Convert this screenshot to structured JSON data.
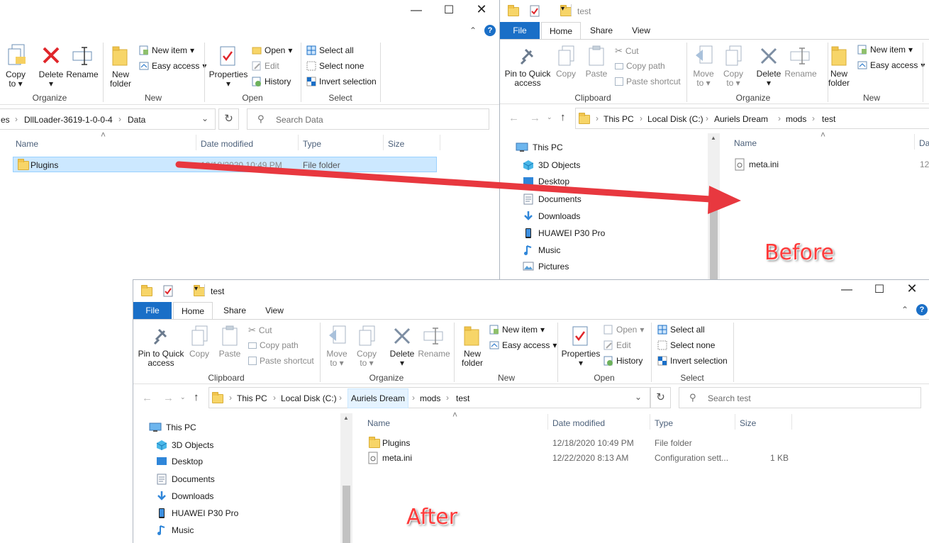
{
  "left_window": {
    "ribbon": {
      "copy_to": "Copy to",
      "delete": "Delete",
      "rename": "Rename",
      "new_folder": "New folder",
      "new_item": "New item",
      "easy_access": "Easy access",
      "properties": "Properties",
      "open": "Open",
      "edit": "Edit",
      "history": "History",
      "select_all": "Select all",
      "select_none": "Select none",
      "invert_selection": "Invert selection",
      "groups": {
        "organize": "Organize",
        "new": "New",
        "open": "Open",
        "select": "Select"
      }
    },
    "address": {
      "crumbs": [
        "es",
        "DllLoader-3619-1-0-0-4",
        "Data"
      ]
    },
    "search_placeholder": "Search Data",
    "columns": [
      "Name",
      "Date modified",
      "Type",
      "Size"
    ],
    "rows": [
      {
        "name": "Plugins",
        "date": "12/18/2020 10:49 PM",
        "type": "File folder",
        "size": ""
      }
    ]
  },
  "right_window": {
    "title": "test",
    "tabs": [
      "File",
      "Home",
      "Share",
      "View"
    ],
    "ribbon": {
      "pin": "Pin to Quick access",
      "copy": "Copy",
      "paste": "Paste",
      "cut": "Cut",
      "copy_path": "Copy path",
      "paste_shortcut": "Paste shortcut",
      "move_to": "Move to",
      "copy_to": "Copy to",
      "delete": "Delete",
      "rename": "Rename",
      "new_folder": "New folder",
      "new_item": "New item",
      "easy_access": "Easy access",
      "groups": {
        "clipboard": "Clipboard",
        "organize": "Organize",
        "new": "New"
      }
    },
    "address": {
      "crumbs": [
        "This PC",
        "Local Disk (C:)",
        "Auriels Dream",
        "mods",
        "test"
      ]
    },
    "nav": [
      "This PC",
      "3D Objects",
      "Desktop",
      "Documents",
      "Downloads",
      "HUAWEI P30 Pro",
      "Music",
      "Pictures"
    ],
    "columns": [
      "Name",
      "Da"
    ],
    "rows": [
      {
        "name": "meta.ini",
        "date": "12/"
      }
    ]
  },
  "bottom_window": {
    "title": "test",
    "tabs": [
      "File",
      "Home",
      "Share",
      "View"
    ],
    "ribbon": {
      "pin": "Pin to Quick access",
      "copy": "Copy",
      "paste": "Paste",
      "cut": "Cut",
      "copy_path": "Copy path",
      "paste_shortcut": "Paste shortcut",
      "move_to": "Move to",
      "copy_to": "Copy to",
      "delete": "Delete",
      "rename": "Rename",
      "new_folder": "New folder",
      "new_item": "New item",
      "easy_access": "Easy access",
      "properties": "Properties",
      "open": "Open",
      "edit": "Edit",
      "history": "History",
      "select_all": "Select all",
      "select_none": "Select none",
      "invert_selection": "Invert selection",
      "groups": {
        "clipboard": "Clipboard",
        "organize": "Organize",
        "new": "New",
        "open": "Open",
        "select": "Select"
      }
    },
    "address": {
      "crumbs": [
        "This PC",
        "Local Disk (C:)",
        "Auriels Dream",
        "mods",
        "test"
      ]
    },
    "search_placeholder": "Search test",
    "nav": [
      "This PC",
      "3D Objects",
      "Desktop",
      "Documents",
      "Downloads",
      "HUAWEI P30 Pro",
      "Music"
    ],
    "columns": [
      "Name",
      "Date modified",
      "Type",
      "Size"
    ],
    "rows": [
      {
        "name": "Plugins",
        "date": "12/18/2020 10:49 PM",
        "type": "File folder",
        "size": ""
      },
      {
        "name": "meta.ini",
        "date": "12/22/2020 8:13 AM",
        "type": "Configuration sett...",
        "size": "1 KB"
      }
    ]
  },
  "annotations": {
    "before": "Before",
    "after": "After"
  },
  "colors": {
    "file_tab": "#1a6fc7",
    "selection": "#cce8ff",
    "arrow": "#e8383f",
    "label": "#ff3a3a"
  }
}
